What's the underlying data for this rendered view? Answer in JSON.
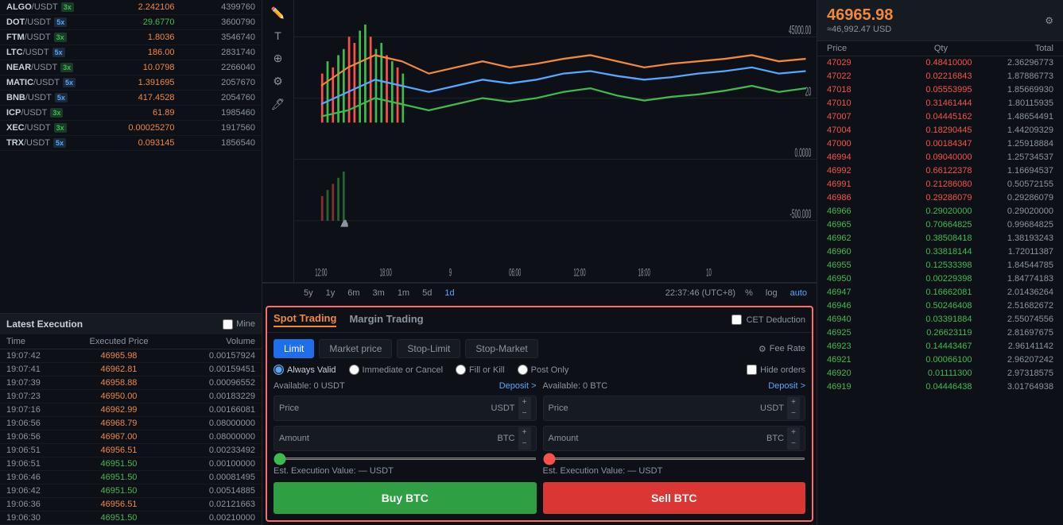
{
  "leftPanel": {
    "coins": [
      {
        "name": "ALGO/USDT",
        "leverage": "3x",
        "leverageType": "3x",
        "price": "2.242106",
        "volume": "4399760",
        "color": "orange"
      },
      {
        "name": "DOT/USDT",
        "leverage": "5x",
        "leverageType": "5x",
        "price": "29.6770",
        "volume": "3600790",
        "color": "green"
      },
      {
        "name": "FTM/USDT",
        "leverage": "3x",
        "leverageType": "3x",
        "price": "1.8036",
        "volume": "3546740",
        "color": "orange"
      },
      {
        "name": "LTC/USDT",
        "leverage": "5x",
        "leverageType": "5x",
        "price": "186.00",
        "volume": "2831740",
        "color": "orange"
      },
      {
        "name": "NEAR/USDT",
        "leverage": "3x",
        "leverageType": "3x",
        "price": "10.0798",
        "volume": "2266040",
        "color": "orange"
      },
      {
        "name": "MATIC/USDT",
        "leverage": "5x",
        "leverageType": "5x",
        "price": "1.391695",
        "volume": "2057670",
        "color": "orange"
      },
      {
        "name": "BNB/USDT",
        "leverage": "5x",
        "leverageType": "5x",
        "price": "417.4528",
        "volume": "2054760",
        "color": "orange"
      },
      {
        "name": "ICP/USDT",
        "leverage": "3x",
        "leverageType": "3x",
        "price": "61.89",
        "volume": "1985460",
        "color": "orange"
      },
      {
        "name": "XEC/USDT",
        "leverage": "3x",
        "leverageType": "3x",
        "price": "0.00025270",
        "volume": "1917560",
        "color": "orange"
      },
      {
        "name": "TRX/USDT",
        "leverage": "5x",
        "leverageType": "5x",
        "price": "0.093145",
        "volume": "1856540",
        "color": "orange"
      }
    ],
    "latestExecution": {
      "title": "Latest Execution",
      "mineLabel": "Mine",
      "columns": [
        "Time",
        "Executed Price",
        "Volume"
      ],
      "rows": [
        {
          "time": "19:07:42",
          "price": "46965.98",
          "volume": "0.00157924",
          "color": "orange"
        },
        {
          "time": "19:07:41",
          "price": "46962.81",
          "volume": "0.00159451",
          "color": "orange"
        },
        {
          "time": "19:07:39",
          "price": "46958.88",
          "volume": "0.00096552",
          "color": "orange"
        },
        {
          "time": "19:07:23",
          "price": "46950.00",
          "volume": "0.00183229",
          "color": "orange"
        },
        {
          "time": "19:07:16",
          "price": "46962.99",
          "volume": "0.00166081",
          "color": "orange"
        },
        {
          "time": "19:06:56",
          "price": "46968.79",
          "volume": "0.08000000",
          "color": "orange"
        },
        {
          "time": "19:06:56",
          "price": "46967.00",
          "volume": "0.08000000",
          "color": "orange"
        },
        {
          "time": "19:06:51",
          "price": "46956.51",
          "volume": "0.00233492",
          "color": "orange"
        },
        {
          "time": "19:06:51",
          "price": "46951.50",
          "volume": "0.00100000",
          "color": "green"
        },
        {
          "time": "19:06:46",
          "price": "46951.50",
          "volume": "0.00081495",
          "color": "green"
        },
        {
          "time": "19:06:42",
          "price": "46951.50",
          "volume": "0.00514885",
          "color": "green"
        },
        {
          "time": "19:06:36",
          "price": "46956.51",
          "volume": "0.02121663",
          "color": "orange"
        },
        {
          "time": "19:06:30",
          "price": "46951.50",
          "volume": "0.00210000",
          "color": "green"
        }
      ]
    }
  },
  "centerPanel": {
    "chartTimeButtons": [
      "5y",
      "1y",
      "6m",
      "3m",
      "1m",
      "5d",
      "1d"
    ],
    "activeTimeButton": "1d",
    "timestamp": "22:37:46 (UTC+8)",
    "chartControls": [
      "%",
      "log",
      "auto"
    ],
    "activeControl": "auto",
    "trading": {
      "tabs": [
        "Spot Trading",
        "Margin Trading"
      ],
      "activeTab": "Spot Trading",
      "cetDeductionLabel": "CET Deduction",
      "orderTypes": [
        "Limit",
        "Market price",
        "Stop-Limit",
        "Stop-Market"
      ],
      "activeOrderType": "Limit",
      "feeRateLabel": "Fee Rate",
      "radioOptions": [
        "Always Valid",
        "Immediate or Cancel",
        "Fill or Kill",
        "Post Only"
      ],
      "activeRadio": "Always Valid",
      "hideOrdersLabel": "Hide orders",
      "buyCol": {
        "availableLabel": "Available: 0 USDT",
        "depositLabel": "Deposit >",
        "pricePlaceholder": "",
        "priceCurrency": "USDT",
        "amountPlaceholder": "",
        "amountCurrency": "BTC",
        "estValueLabel": "Est. Execution Value: — USDT",
        "buyBtnLabel": "Buy BTC"
      },
      "sellCol": {
        "availableLabel": "Available: 0 BTC",
        "depositLabel": "Deposit >",
        "pricePlaceholder": "",
        "priceCurrency": "USDT",
        "amountPlaceholder": "",
        "amountCurrency": "BTC",
        "estValueLabel": "Est. Execution Value: — USDT",
        "sellBtnLabel": "Sell BTC"
      }
    }
  },
  "rightPanel": {
    "currentPrice": "46965.98",
    "priceUSD": "≈46,992.47 USD",
    "orderbook": {
      "columns": [
        "Price",
        "Qty",
        "Total"
      ],
      "asks": [
        {
          "price": "47029",
          "qty": "0.48410000",
          "total": "2.36296773"
        },
        {
          "price": "47022",
          "qty": "0.02216843",
          "total": "1.87886773"
        },
        {
          "price": "47018",
          "qty": "0.05553995",
          "total": "1.85669930"
        },
        {
          "price": "47010",
          "qty": "0.31461444",
          "total": "1.80115935"
        },
        {
          "price": "47007",
          "qty": "0.04445162",
          "total": "1.48654491"
        },
        {
          "price": "47004",
          "qty": "0.18290445",
          "total": "1.44209329"
        },
        {
          "price": "47000",
          "qty": "0.00184347",
          "total": "1.25918884"
        },
        {
          "price": "46994",
          "qty": "0.09040000",
          "total": "1.25734537"
        },
        {
          "price": "46992",
          "qty": "0.66122378",
          "total": "1.16694537"
        },
        {
          "price": "46991",
          "qty": "0.21286080",
          "total": "0.50572155"
        },
        {
          "price": "46986",
          "qty": "0.29286079",
          "total": "0.29286079"
        }
      ],
      "bids": [
        {
          "price": "46966",
          "qty": "0.29020000",
          "total": "0.29020000"
        },
        {
          "price": "46965",
          "qty": "0.70664825",
          "total": "0.99684825"
        },
        {
          "price": "46962",
          "qty": "0.38508418",
          "total": "1.38193243"
        },
        {
          "price": "46960",
          "qty": "0.33818144",
          "total": "1.72011387"
        },
        {
          "price": "46955",
          "qty": "0.12533398",
          "total": "1.84544785"
        },
        {
          "price": "46950",
          "qty": "0.00229398",
          "total": "1.84774183"
        },
        {
          "price": "46947",
          "qty": "0.16662081",
          "total": "2.01436264"
        },
        {
          "price": "46946",
          "qty": "0.50246408",
          "total": "2.51682672"
        },
        {
          "price": "46940",
          "qty": "0.03391884",
          "total": "2.55074556"
        },
        {
          "price": "46925",
          "qty": "0.26623119",
          "total": "2.81697675"
        },
        {
          "price": "46923",
          "qty": "0.14443467",
          "total": "2.96141142"
        },
        {
          "price": "46921",
          "qty": "0.00066100",
          "total": "2.96207242"
        },
        {
          "price": "46920",
          "qty": "0.01111300",
          "total": "2.97318575"
        },
        {
          "price": "46919",
          "qty": "0.04446438",
          "total": "3.01764938"
        }
      ]
    }
  }
}
